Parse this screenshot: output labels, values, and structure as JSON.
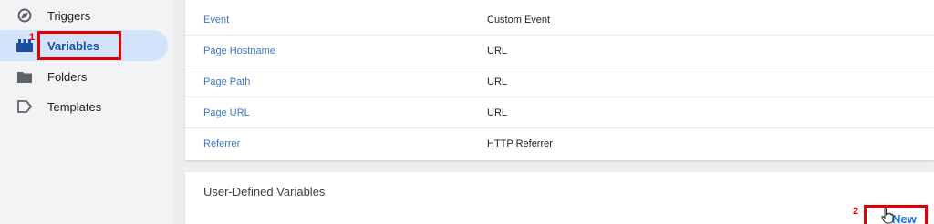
{
  "sidebar": {
    "items": [
      {
        "label": "Triggers",
        "icon": "trigger-icon"
      },
      {
        "label": "Variables",
        "icon": "variables-icon",
        "active": true
      },
      {
        "label": "Folders",
        "icon": "folder-icon"
      },
      {
        "label": "Templates",
        "icon": "template-icon"
      }
    ]
  },
  "builtin": {
    "rows": [
      {
        "name": "Event",
        "type": "Custom Event"
      },
      {
        "name": "Page Hostname",
        "type": "URL"
      },
      {
        "name": "Page Path",
        "type": "URL"
      },
      {
        "name": "Page URL",
        "type": "URL"
      },
      {
        "name": "Referrer",
        "type": "HTTP Referrer"
      }
    ]
  },
  "user_defined": {
    "title": "User-Defined Variables",
    "new_label": "New"
  },
  "annotations": {
    "step1": "1",
    "step2": "2"
  },
  "colors": {
    "accent": "#1a73e8",
    "active_bg": "#d2e3fc",
    "annotation": "#e00000",
    "link": "#3b78c4"
  }
}
